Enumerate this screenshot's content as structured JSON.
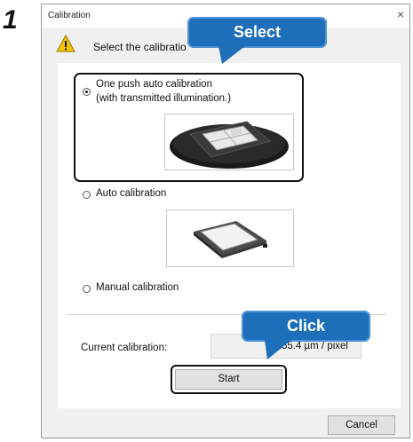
{
  "step_number": "1",
  "dialog": {
    "title": "Calibration",
    "close_glyph": "×",
    "header_text": "Select the calibratio",
    "warning_icon": "warning-icon"
  },
  "options": [
    {
      "label_line1": "One push auto calibration",
      "label_line2": "(with transmitted illumination.)",
      "selected": true
    },
    {
      "label_line1": "Auto calibration",
      "selected": false
    },
    {
      "label_line1": "Manual calibration",
      "selected": false
    }
  ],
  "current_calibration": {
    "label": "Current calibration:",
    "value": "55.4 µm / pixel"
  },
  "buttons": {
    "start": "Start",
    "cancel": "Cancel"
  },
  "callouts": {
    "select": "Select",
    "click": "Click"
  },
  "colors": {
    "callout": "#1e6fba",
    "warning": "#f2c200",
    "dialog_bg": "#f0f0f0"
  }
}
